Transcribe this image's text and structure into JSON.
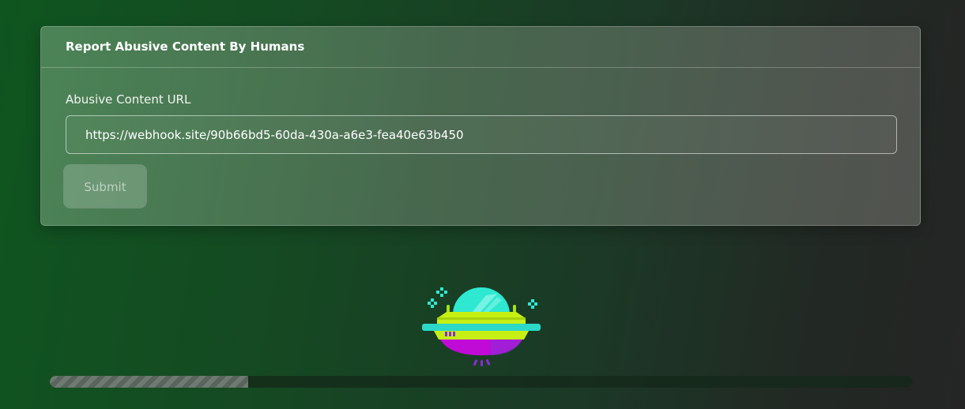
{
  "form": {
    "title": "Report Abusive Content By Humans",
    "url_label": "Abusive Content URL",
    "url_value": "https://webhook.site/90b66bd5-60da-430a-a6e3-fea40e63b450",
    "submit_label": "Submit",
    "submit_disabled": true
  },
  "progress": {
    "fraction": 0.23
  },
  "colors": {
    "ufo_dome": "#2ee8d2",
    "ufo_band_top": "#c6ef14",
    "ufo_band_bottom": "#c00ad6",
    "ufo_rim": "#2cd8c8",
    "accent_green": "#0f5520"
  },
  "icons": {
    "illustration": "ufo-icon",
    "sparkle": "sparkle-icon"
  }
}
